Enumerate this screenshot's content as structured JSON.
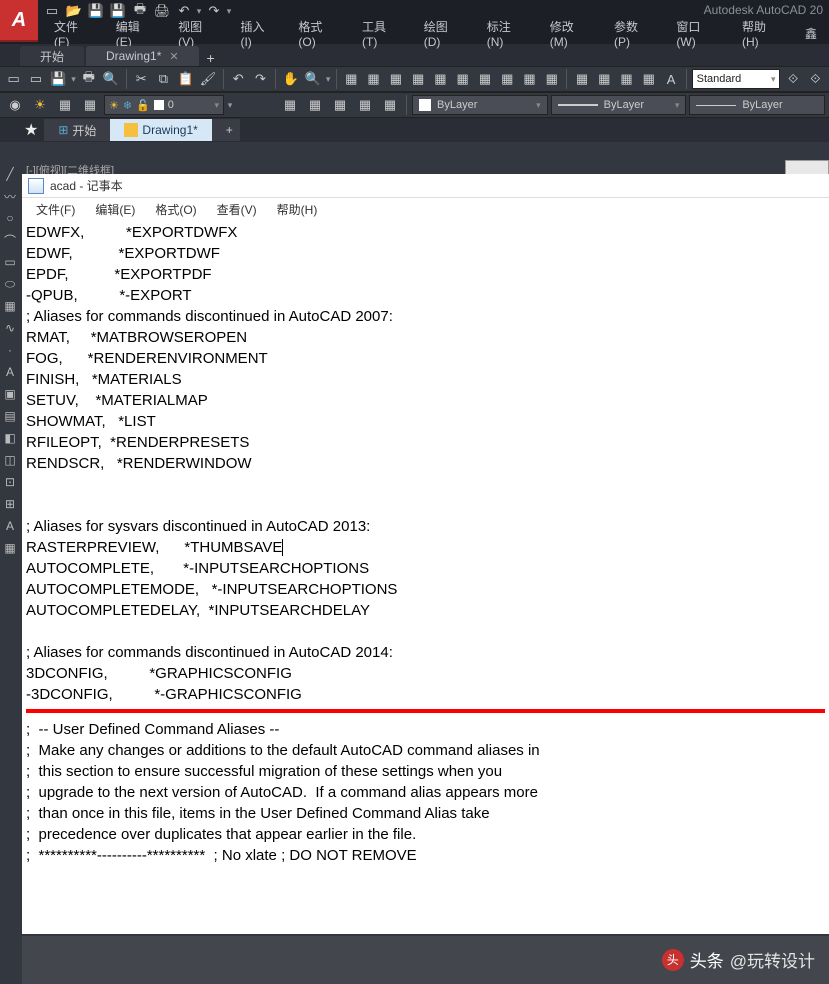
{
  "app": {
    "title": "Autodesk AutoCAD 20",
    "logo_letter": "A"
  },
  "menubar": [
    "文件(F)",
    "编辑(E)",
    "视图(V)",
    "插入(I)",
    "格式(O)",
    "工具(T)",
    "绘图(D)",
    "标注(N)",
    "修改(M)",
    "参数(P)",
    "窗口(W)",
    "帮助(H)"
  ],
  "doctabs": {
    "items": [
      {
        "label": "开始",
        "active": false,
        "closable": false
      },
      {
        "label": "Drawing1*",
        "active": true,
        "closable": true
      }
    ],
    "add": "+"
  },
  "toolbar2": {
    "layer_combo": "0",
    "style_combo": "Standard"
  },
  "bylayer": {
    "label1": "ByLayer",
    "label2": "ByLayer",
    "label3": "ByLayer"
  },
  "subtabs": {
    "home": "开始",
    "drawing": "Drawing1*",
    "add": "+"
  },
  "subheader": "[-][俯视][二维线框]",
  "notepad": {
    "title": "acad - 记事本",
    "menu": [
      "文件(F)",
      "编辑(E)",
      "格式(O)",
      "查看(V)",
      "帮助(H)"
    ],
    "lines_top": [
      "EDWFX,          *EXPORTDWFX",
      "EDWF,           *EXPORTDWF",
      "EPDF,           *EXPORTPDF",
      "-QPUB,          *-EXPORT",
      "; Aliases for commands discontinued in AutoCAD 2007:",
      "RMAT,     *MATBROWSEROPEN",
      "FOG,      *RENDERENVIRONMENT",
      "FINISH,   *MATERIALS",
      "SETUV,    *MATERIALMAP",
      "SHOWMAT,   *LIST",
      "RFILEOPT,  *RENDERPRESETS",
      "RENDSCR,   *RENDERWINDOW",
      "",
      "",
      "; Aliases for sysvars discontinued in AutoCAD 2013:"
    ],
    "line_caret": "RASTERPREVIEW,      *THUMBSAVE",
    "lines_mid": [
      "AUTOCOMPLETE,       *-INPUTSEARCHOPTIONS",
      "AUTOCOMPLETEMODE,   *-INPUTSEARCHOPTIONS",
      "AUTOCOMPLETEDELAY,  *INPUTSEARCHDELAY",
      "",
      "; Aliases for commands discontinued in AutoCAD 2014:",
      "3DCONFIG,          *GRAPHICSCONFIG",
      "-3DCONFIG,          *-GRAPHICSCONFIG"
    ],
    "lines_bottom": [
      ";  -- User Defined Command Aliases --",
      ";  Make any changes or additions to the default AutoCAD command aliases in",
      ";  this section to ensure successful migration of these settings when you",
      ";  upgrade to the next version of AutoCAD.  If a command alias appears more",
      ";  than once in this file, items in the User Defined Command Alias take",
      ";  precedence over duplicates that appear earlier in the file.",
      ";  **********----------**********  ; No xlate ; DO NOT REMOVE"
    ]
  },
  "watermark": {
    "prefix": "头条",
    "handle": "@玩转设计"
  },
  "extra": "鑫"
}
